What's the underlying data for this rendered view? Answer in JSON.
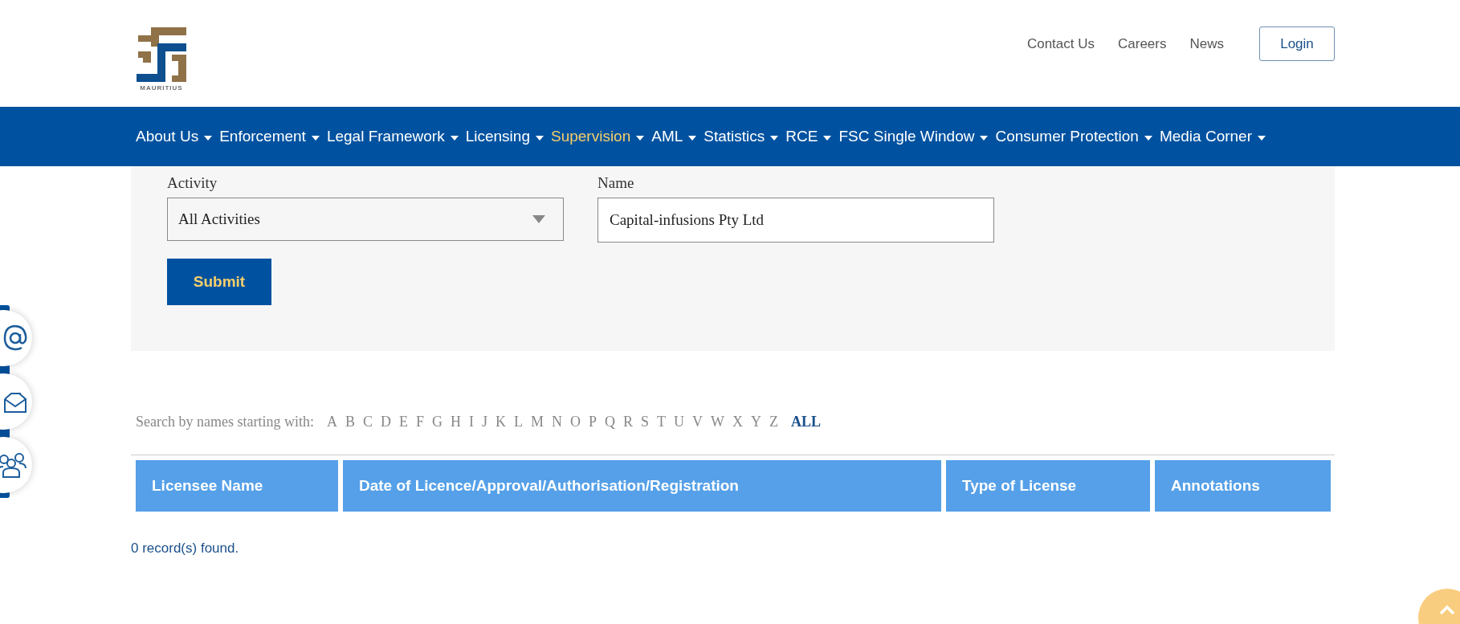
{
  "header": {
    "logo_text": "MAURITIUS",
    "links": [
      "Contact Us",
      "Careers",
      "News"
    ],
    "login": "Login"
  },
  "nav": [
    {
      "label": "About Us",
      "selected": false
    },
    {
      "label": "Enforcement",
      "selected": false
    },
    {
      "label": "Legal Framework",
      "selected": false
    },
    {
      "label": "Licensing",
      "selected": false
    },
    {
      "label": "Supervision",
      "selected": true
    },
    {
      "label": "AML",
      "selected": false
    },
    {
      "label": "Statistics",
      "selected": false
    },
    {
      "label": "RCE",
      "selected": false
    },
    {
      "label": "FSC Single Window",
      "selected": false
    },
    {
      "label": "Consumer Protection",
      "selected": false
    },
    {
      "label": "Media Corner",
      "selected": false
    }
  ],
  "form": {
    "activity_label": "Activity",
    "activity_value": "All Activities",
    "name_label": "Name",
    "name_value": "Capital-infusions Pty Ltd",
    "submit": "Submit"
  },
  "alphabet": {
    "label": "Search by names starting with:",
    "letters": [
      {
        "label": "A",
        "selected": false
      },
      {
        "label": "B",
        "selected": false
      },
      {
        "label": "C",
        "selected": false
      },
      {
        "label": "D",
        "selected": false
      },
      {
        "label": "E",
        "selected": false
      },
      {
        "label": "F",
        "selected": false
      },
      {
        "label": "G",
        "selected": false
      },
      {
        "label": "H",
        "selected": false
      },
      {
        "label": "I",
        "selected": false
      },
      {
        "label": "J",
        "selected": false
      },
      {
        "label": "K",
        "selected": false
      },
      {
        "label": "L",
        "selected": false
      },
      {
        "label": "M",
        "selected": false
      },
      {
        "label": "N",
        "selected": false
      },
      {
        "label": "O",
        "selected": false
      },
      {
        "label": "P",
        "selected": false
      },
      {
        "label": "Q",
        "selected": false
      },
      {
        "label": "R",
        "selected": false
      },
      {
        "label": "S",
        "selected": false
      },
      {
        "label": "T",
        "selected": false
      },
      {
        "label": "U",
        "selected": false
      },
      {
        "label": "V",
        "selected": false
      },
      {
        "label": "W",
        "selected": false
      },
      {
        "label": "X",
        "selected": false
      },
      {
        "label": "Y",
        "selected": false
      },
      {
        "label": "Z",
        "selected": false
      },
      {
        "label": "ALL",
        "selected": true
      }
    ]
  },
  "table": {
    "columns": [
      "Licensee Name",
      "Date of Licence/Approval/Authorisation/Registration",
      "Type of License",
      "Annotations"
    ]
  },
  "status": "0 record(s) found."
}
